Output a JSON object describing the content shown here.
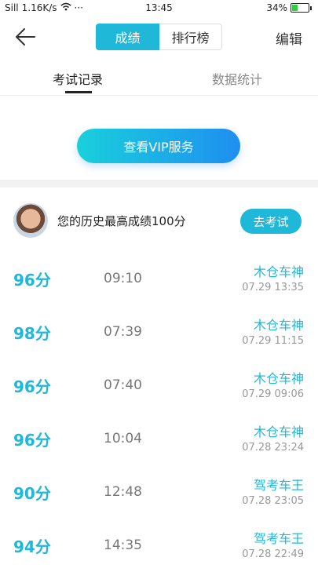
{
  "status_bar": {
    "signal": "Sill",
    "speed": "1.16K/s",
    "more": "···",
    "time": "13:45",
    "battery": "34%",
    "battery_level": 0.34
  },
  "nav": {
    "segment_active": "成绩",
    "segment_inactive": "排行榜",
    "edit_label": "编辑"
  },
  "tabs": [
    "考试记录",
    "数据统计"
  ],
  "vip_button": "查看VIP服务",
  "best": {
    "text": "您的历史最高成绩100分",
    "button": "去考试"
  },
  "records": [
    {
      "score": "96分",
      "duration": "09:10",
      "title": "木仓车神",
      "date": "07.29  13:35"
    },
    {
      "score": "98分",
      "duration": "07:39",
      "title": "木仓车神",
      "date": "07.29  11:15"
    },
    {
      "score": "96分",
      "duration": "07:40",
      "title": "木仓车神",
      "date": "07.29  09:06"
    },
    {
      "score": "96分",
      "duration": "10:04",
      "title": "木仓车神",
      "date": "07.28  23:24"
    },
    {
      "score": "90分",
      "duration": "12:48",
      "title": "驾考车王",
      "date": "07.28  23:05"
    },
    {
      "score": "94分",
      "duration": "14:35",
      "title": "驾考车王",
      "date": "07.28  22:49"
    }
  ]
}
